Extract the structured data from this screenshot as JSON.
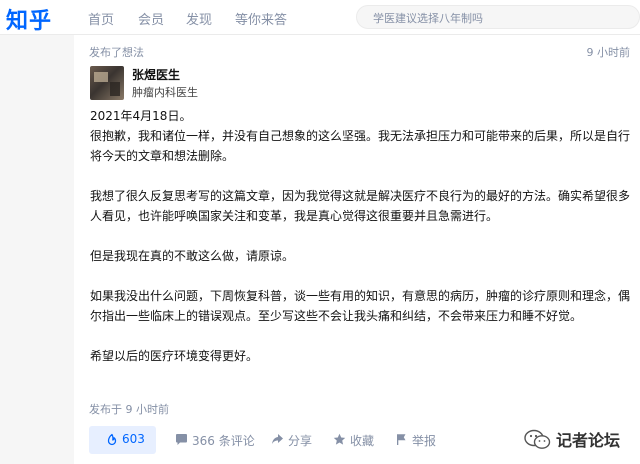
{
  "header": {
    "logo": "知乎",
    "nav": [
      "首页",
      "会员",
      "发现",
      "等你来答"
    ],
    "search_placeholder": "学医建议选择八年制吗"
  },
  "post": {
    "action_label": "发布了想法",
    "time_ago": "9 小时前",
    "author_name": "张煜医生",
    "author_title": "肿瘤内科医生",
    "date_line": "2021年4月18日。",
    "paragraphs": [
      "很抱歉，我和诸位一样，并没有自己想象的这么坚强。我无法承担压力和可能带来的后果，所以是自行将今天的文章和想法删除。",
      "我想了很久反复思考写的这篇文章，因为我觉得这就是解决医疗不良行为的最好的方法。确实希望很多人看见，也许能呼唤国家关注和变革，我是真心觉得这很重要并且急需进行。",
      "但是我现在真的不敢这么做，请原谅。",
      "如果我没出什么问题，下周恢复科普，谈一些有用的知识，有意思的病历，肿瘤的诊疗原则和理念，偶尔指出一些临床上的错误观点。至少写这些不会让我头痛和纠结，不会带来压力和睡不好觉。",
      "希望以后的医疗环境变得更好。"
    ],
    "published": "发布于 9 小时前"
  },
  "actions": {
    "vote_count": "603",
    "comments": "366 条评论",
    "share": "分享",
    "favorite": "收藏",
    "report": "举报"
  },
  "watermark": {
    "icon": "wechat-icon",
    "text": "记者论坛"
  },
  "colors": {
    "brand": "#0066ff",
    "muted": "#8590a6",
    "vote_bg": "#e7efff"
  }
}
